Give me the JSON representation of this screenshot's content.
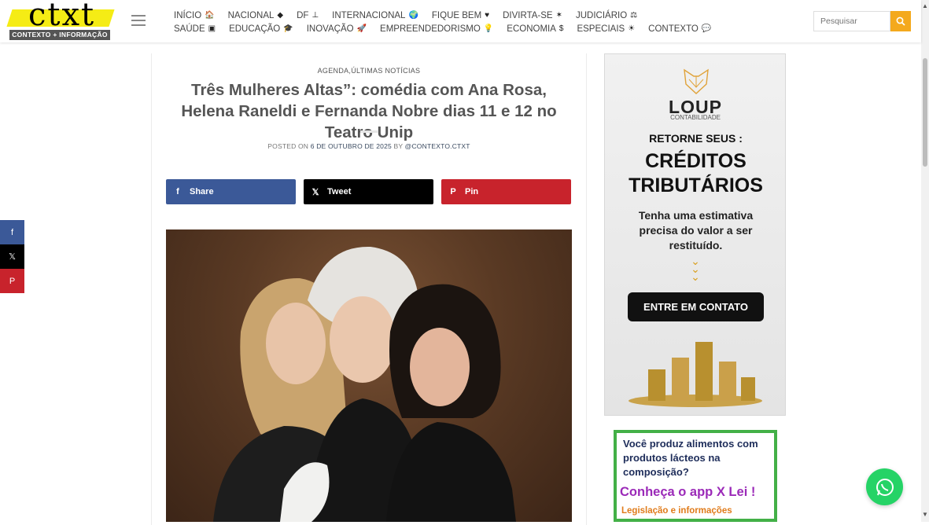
{
  "header": {
    "logo_text": "ctxt",
    "logo_tagline": "CONTEXTO + INFORMAÇÃO",
    "nav_row1": [
      {
        "label": "INÍCIO",
        "icon": "🏠"
      },
      {
        "label": "NACIONAL",
        "icon": "◆"
      },
      {
        "label": "DF",
        "icon": "⊥"
      },
      {
        "label": "INTERNACIONAL",
        "icon": "🌍"
      },
      {
        "label": "FIQUE BEM",
        "icon": "♥"
      },
      {
        "label": "DIVIRTA-SE",
        "icon": "✶"
      },
      {
        "label": "JUDICIÁRIO",
        "icon": "⚖"
      }
    ],
    "nav_row2": [
      {
        "label": "SAÚDE",
        "icon": "▣"
      },
      {
        "label": "EDUCAÇÃO",
        "icon": "🎓"
      },
      {
        "label": "INOVAÇÃO",
        "icon": "🚀"
      },
      {
        "label": "EMPREENDEDORISMO",
        "icon": "💡"
      },
      {
        "label": "ECONOMIA",
        "icon": "$"
      },
      {
        "label": "ESPECIAIS",
        "icon": "☀"
      },
      {
        "label": "CONTEXTO",
        "icon": "💬"
      }
    ],
    "search_placeholder": "Pesquisar",
    "accent": "#f4a91d"
  },
  "article": {
    "categories": "AGENDA,ÚLTIMAS NOTÍCIAS",
    "title": "Três Mulheres Altas”: comédia com Ana Rosa, Helena Raneldi e Fernanda Nobre dias 11 e 12 no Teatro Unip",
    "posted_on": "POSTED ON",
    "date": "6 DE OUTUBRO DE 2025",
    "by": "BY",
    "author": "@CONTEXTO.CTXT",
    "share": {
      "facebook": "Share",
      "twitter": "Tweet",
      "pinterest": "Pin"
    }
  },
  "sidebar": {
    "ad1": {
      "brand": "LOUP",
      "brand_sub": "CONTABILIDADE",
      "headline1": "RETORNE SEUS :",
      "headline2": "CRÉDITOS TRIBUTÁRIOS",
      "body": "Tenha uma estimativa precisa do valor a ser restituído.",
      "cta": "ENTRE EM CONTATO"
    },
    "ad2": {
      "question": "Você produz alimentos com produtos lácteos na composição?",
      "app": "Conheça o app X Lei !",
      "sub": "Legislação e informações"
    }
  },
  "colors": {
    "facebook": "#3b5998",
    "twitter": "#000000",
    "pinterest": "#c8232c",
    "whatsapp": "#25d366"
  }
}
